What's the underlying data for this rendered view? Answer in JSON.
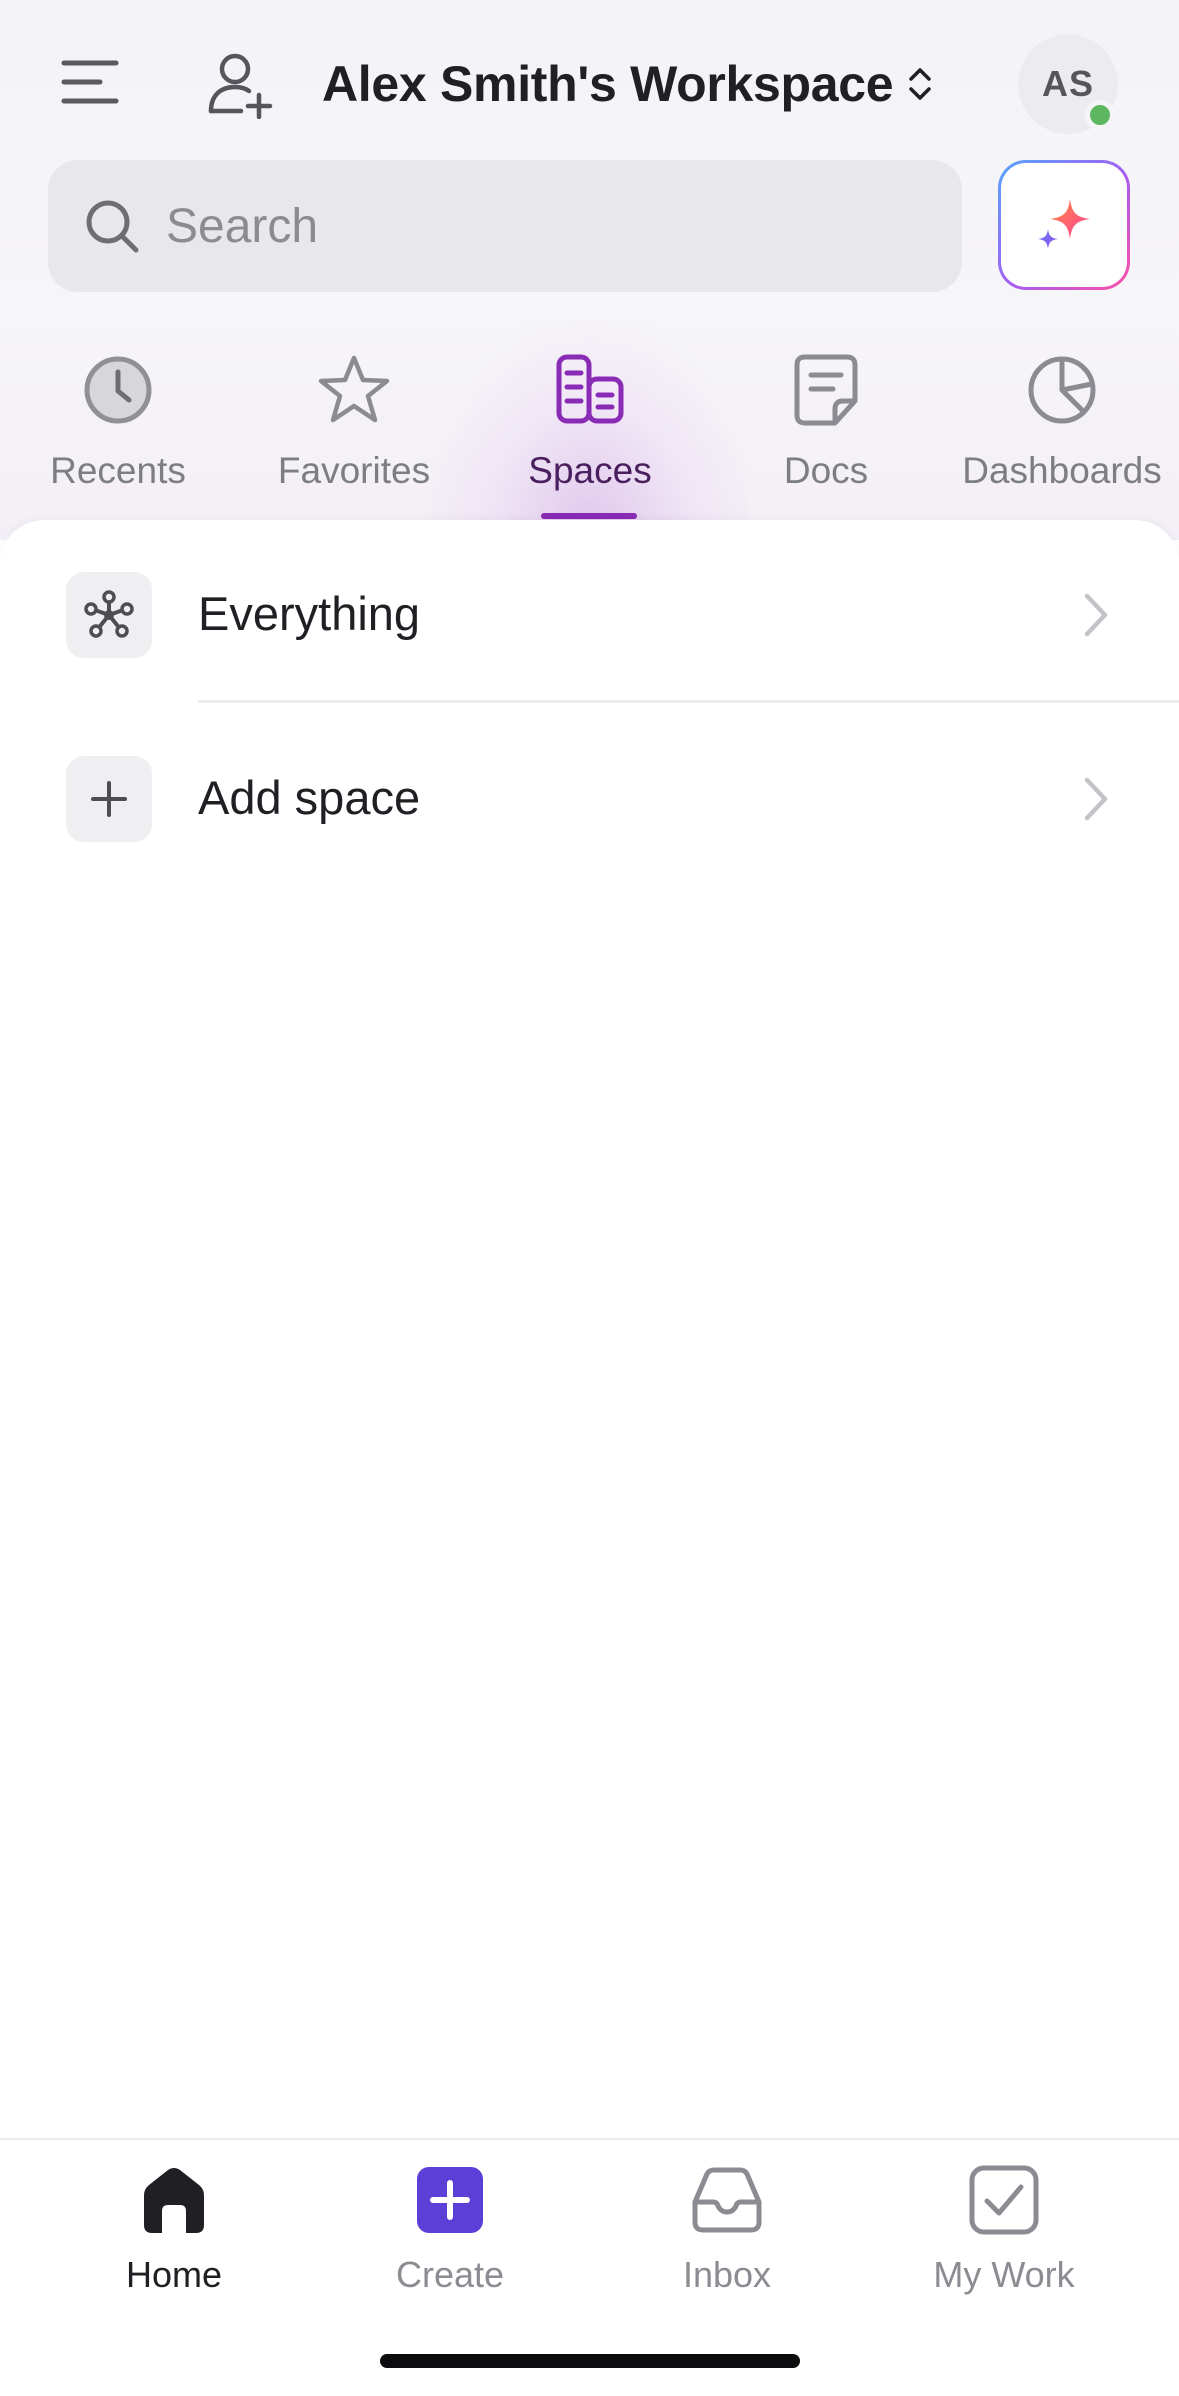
{
  "header": {
    "workspace_title": "Alex Smith's Workspace",
    "avatar_initials": "AS",
    "status_color": "#5db760"
  },
  "search": {
    "placeholder": "Search",
    "value": ""
  },
  "tabs": [
    {
      "label": "Recents",
      "icon": "clock-icon",
      "active": false
    },
    {
      "label": "Favorites",
      "icon": "star-icon",
      "active": false
    },
    {
      "label": "Spaces",
      "icon": "spaces-icon",
      "active": true
    },
    {
      "label": "Docs",
      "icon": "doc-icon",
      "active": false
    },
    {
      "label": "Dashboards",
      "icon": "pie-chart-icon",
      "active": false
    }
  ],
  "spaces_list": [
    {
      "label": "Everything",
      "icon": "hub-icon"
    },
    {
      "label": "Add space",
      "icon": "plus-icon"
    }
  ],
  "bottom_nav": [
    {
      "label": "Home",
      "icon": "home-icon",
      "active": true
    },
    {
      "label": "Create",
      "icon": "create-icon",
      "active": false
    },
    {
      "label": "Inbox",
      "icon": "inbox-icon",
      "active": false
    },
    {
      "label": "My Work",
      "icon": "checkbox-icon",
      "active": false
    }
  ],
  "colors": {
    "accent": "#8a2bb5",
    "create": "#5b3fd6",
    "active_tab_text": "#4a1f5e"
  }
}
